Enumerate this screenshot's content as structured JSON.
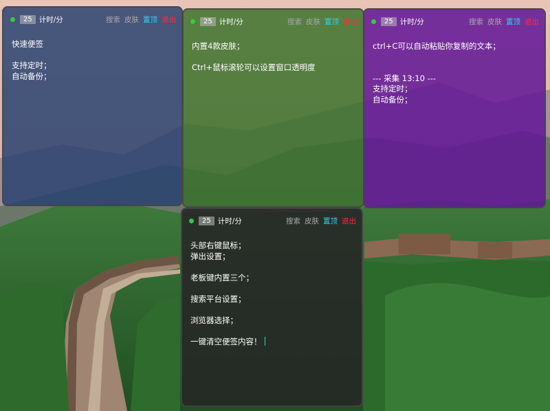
{
  "notes": [
    {
      "id": "blue",
      "timer_value": "25",
      "timer_label": "计时/分",
      "actions": {
        "search": "搜索",
        "skin": "皮肤",
        "top": "置顶",
        "exit": "退出"
      },
      "content": "快速便签\n\n支持定时；\n自动备份；"
    },
    {
      "id": "green",
      "timer_value": "25",
      "timer_label": "计时/分",
      "actions": {
        "search": "搜索",
        "skin": "皮肤",
        "top": "置顶",
        "exit": "退出"
      },
      "content": "内置4款皮肤；\n\nCtrl+鼠标滚轮可以设置窗口透明度"
    },
    {
      "id": "purple",
      "timer_value": "25",
      "timer_label": "计时/分",
      "actions": {
        "search": "搜索",
        "skin": "皮肤",
        "top": "置顶",
        "exit": "退出"
      },
      "content": "ctrl+C可以自动粘贴你复制的文本；\n\n\n--- 采集 13:10 ---\n支持定时；\n自动备份；"
    },
    {
      "id": "dark",
      "timer_value": "25",
      "timer_label": "计时/分",
      "actions": {
        "search": "搜索",
        "skin": "皮肤",
        "top": "置顶",
        "exit": "退出"
      },
      "content": "头部右键鼠标；\n弹出设置；\n\n老板键内置三个；\n\n搜索平台设置；\n\n浏览器选择；\n\n一键清空便签内容！"
    }
  ],
  "colors": {
    "blue_skin": "#284170",
    "green_skin": "#377028",
    "purple_skin": "#621696",
    "dark_skin": "#262626",
    "status_dot": "#36c93c",
    "pin_action": "#2fd2f0",
    "exit_action": "#ff2a3a",
    "muted_action": "#a9a9a9"
  },
  "icons": {
    "status": "green-dot-icon",
    "caret": "text-cursor-icon"
  }
}
